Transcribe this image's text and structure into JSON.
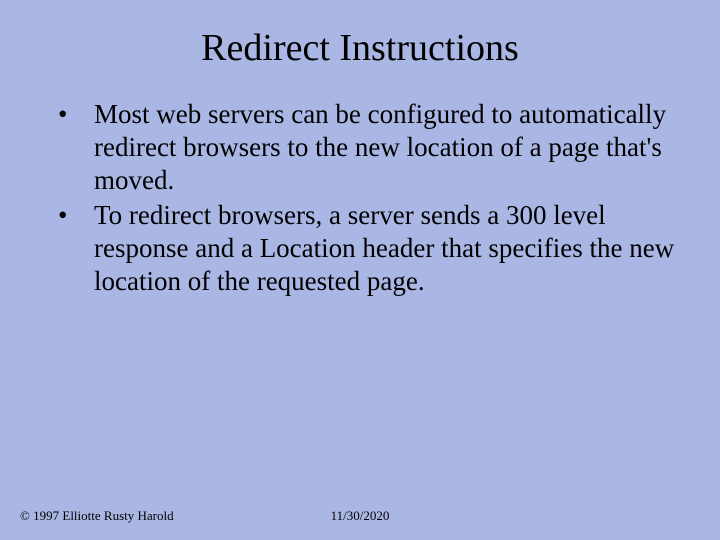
{
  "title": "Redirect Instructions",
  "bullets": [
    "Most web servers can be configured to automatically redirect browsers to the new location of a page that's moved.",
    "To redirect browsers, a server sends a 300 level response and a Location header that specifies the new location of the requested page."
  ],
  "footer": {
    "copyright": "© 1997 Elliotte Rusty Harold",
    "date": "11/30/2020"
  }
}
